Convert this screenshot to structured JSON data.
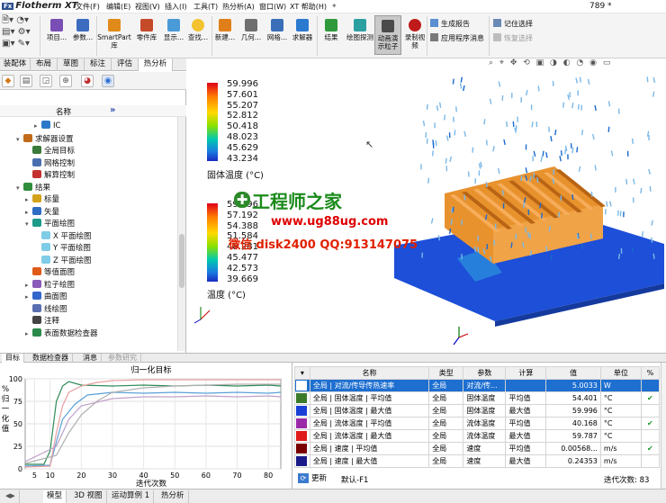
{
  "app": {
    "logo_prefix": "Fx",
    "logo": "Flotherm XT",
    "title_right": "789 *"
  },
  "menu": [
    "文件(F)",
    "编辑(E)",
    "视图(V)",
    "插入(I)",
    "工具(T)",
    "热分析(A)",
    "窗口(W)",
    "XT 帮助(H)"
  ],
  "ribbon": {
    "items": [
      "项目...",
      "参数...",
      "SmartPart 库",
      "零件库",
      "显示...",
      "查找...",
      "新建...",
      "几何...",
      "网格...",
      "求解器",
      "结果",
      "绘图探测",
      "动画演示粒子",
      "录制视频"
    ],
    "right": [
      "生成报告",
      "应用程序消息",
      "记住选择",
      "恢复选择"
    ]
  },
  "left_tabs": [
    "装配体",
    "布局",
    "草图",
    "标注",
    "评估",
    "热分析"
  ],
  "tree": {
    "col_name": "名称",
    "col_arrow": "»",
    "nodes": [
      {
        "label": "IC",
        "depth": 3,
        "exp": "▸",
        "color": "#2a79c8"
      },
      {
        "label": "求解器设置",
        "depth": 1,
        "exp": "▾",
        "color": "#c06a1a"
      },
      {
        "label": "全局目标",
        "depth": 2,
        "exp": "",
        "color": "#3a7a3a"
      },
      {
        "label": "网格控制",
        "depth": 2,
        "exp": "",
        "color": "#4a6fb0"
      },
      {
        "label": "解算控制",
        "depth": 2,
        "exp": "",
        "color": "#c43030"
      },
      {
        "label": "结果",
        "depth": 1,
        "exp": "▾",
        "color": "#2f8d3c"
      },
      {
        "label": "标量",
        "depth": 2,
        "exp": "▸",
        "color": "#d3a21a"
      },
      {
        "label": "矢量",
        "depth": 2,
        "exp": "▸",
        "color": "#2f6cc4"
      },
      {
        "label": "平面绘图",
        "depth": 2,
        "exp": "▾",
        "color": "#1c9a8a"
      },
      {
        "label": "X 平面绘图",
        "depth": 3,
        "exp": "",
        "color": "#7fcce8"
      },
      {
        "label": "Y 平面绘图",
        "depth": 3,
        "exp": "",
        "color": "#7fcce8"
      },
      {
        "label": "Z 平面绘图",
        "depth": 3,
        "exp": "",
        "color": "#7fcce8"
      },
      {
        "label": "等值面图",
        "depth": 2,
        "exp": "",
        "color": "#e05a1a"
      },
      {
        "label": "粒子绘图",
        "depth": 2,
        "exp": "▸",
        "color": "#8a5ab8"
      },
      {
        "label": "曲面图",
        "depth": 2,
        "exp": "▸",
        "color": "#3366cc"
      },
      {
        "label": "线绘图",
        "depth": 2,
        "exp": "",
        "color": "#5a6fb0"
      },
      {
        "label": "注释",
        "depth": 2,
        "exp": "",
        "color": "#444"
      },
      {
        "label": "表面数据检查器",
        "depth": 2,
        "exp": "▸",
        "color": "#2a8a4a"
      }
    ]
  },
  "legend1": {
    "values": [
      "59.996",
      "57.601",
      "55.207",
      "52.812",
      "50.418",
      "48.023",
      "45.629",
      "43.234"
    ],
    "title": "固体温度 (°C)"
  },
  "legend2": {
    "values": [
      "59.996",
      "57.192",
      "54.388",
      "51.584",
      "48.281",
      "45.477",
      "42.573",
      "39.669"
    ],
    "title": "温度 (°C)"
  },
  "watermark": {
    "line1": "工程师之家",
    "line2": "www.ug88ug.com",
    "line3": "微信 disk2400 QQ:913147075"
  },
  "bottom_tabs": [
    "目标",
    "数据检查器",
    "消息",
    "参数研究"
  ],
  "chart_data": {
    "type": "line",
    "title": "归一化目标",
    "xlabel": "迭代次数",
    "ylabel": "% 归一化值",
    "x_ticks": [
      5,
      10,
      20,
      30,
      40,
      50,
      60,
      70,
      80
    ],
    "y_ticks": [
      100,
      75,
      50,
      25,
      0
    ],
    "xlim": [
      2,
      84
    ],
    "ylim": [
      0,
      100
    ],
    "series": [
      {
        "color": "#2e8b57",
        "x": [
          2,
          8,
          10,
          12,
          14,
          16,
          20,
          30,
          40,
          50,
          60,
          70,
          80,
          84
        ],
        "y": [
          5,
          5,
          20,
          75,
          92,
          97,
          93,
          92,
          93,
          92,
          93,
          92,
          93,
          92
        ]
      },
      {
        "color": "#5aa0d8",
        "x": [
          2,
          10,
          12,
          14,
          18,
          22,
          30,
          40,
          50,
          60,
          70,
          80,
          84
        ],
        "y": [
          3,
          4,
          30,
          55,
          72,
          82,
          85,
          84,
          85,
          84,
          85,
          84,
          85
        ]
      },
      {
        "color": "#e8a0a0",
        "x": [
          2,
          10,
          12,
          14,
          16,
          20,
          25,
          30,
          40,
          50,
          60,
          70,
          80,
          84
        ],
        "y": [
          2,
          3,
          40,
          70,
          85,
          92,
          96,
          98,
          99,
          99,
          99,
          99,
          99,
          99
        ]
      },
      {
        "color": "#b0b0b0",
        "x": [
          2,
          12,
          16,
          20,
          25,
          30,
          40,
          50,
          60,
          70,
          80,
          84
        ],
        "y": [
          6,
          15,
          40,
          60,
          75,
          85,
          90,
          92,
          93,
          94,
          94,
          94
        ]
      },
      {
        "color": "#c0a0c8",
        "x": [
          2,
          12,
          16,
          20,
          30,
          40,
          50,
          60,
          70,
          80,
          84
        ],
        "y": [
          8,
          25,
          55,
          70,
          78,
          80,
          80,
          81,
          80,
          81,
          80
        ]
      }
    ]
  },
  "goals": {
    "headers": [
      "名称",
      "类型",
      "参数",
      "计算",
      "值",
      "单位",
      "%"
    ],
    "rows": [
      {
        "color": "#ffffff",
        "name": "全局 | 对流/传导传热速率",
        "type": "全局",
        "param": "对流/传...",
        "calc": "",
        "value": "5.0033",
        "unit": "W",
        "pct": "",
        "sel": true
      },
      {
        "color": "#3c7a2a",
        "name": "全局 | 固体温度 | 平均值",
        "type": "全局",
        "param": "固体温度",
        "calc": "平均值",
        "value": "54.401",
        "unit": "°C",
        "pct": "✔",
        "sel": false
      },
      {
        "color": "#1a3fd6",
        "name": "全局 | 固体温度 | 最大值",
        "type": "全局",
        "param": "固体温度",
        "calc": "最大值",
        "value": "59.996",
        "unit": "°C",
        "pct": "",
        "sel": false
      },
      {
        "color": "#9b2aa8",
        "name": "全局 | 流体温度 | 平均值",
        "type": "全局",
        "param": "流体温度",
        "calc": "平均值",
        "value": "40.168",
        "unit": "°C",
        "pct": "✔",
        "sel": false
      },
      {
        "color": "#e01a1a",
        "name": "全局 | 流体温度 | 最大值",
        "type": "全局",
        "param": "流体温度",
        "calc": "最大值",
        "value": "59.787",
        "unit": "°C",
        "pct": "",
        "sel": false
      },
      {
        "color": "#7a0000",
        "name": "全局 | 速度 | 平均值",
        "type": "全局",
        "param": "速度",
        "calc": "平均值",
        "value": "0.00568...",
        "unit": "m/s",
        "pct": "✔",
        "sel": false
      },
      {
        "color": "#1a1a8a",
        "name": "全局 | 速度 | 最大值",
        "type": "全局",
        "param": "速度",
        "calc": "最大值",
        "value": "0.24353",
        "unit": "m/s",
        "pct": "",
        "sel": false
      }
    ],
    "update_label": "更新",
    "default_label": "默认-F1",
    "iter_label": "迭代次数: 83"
  },
  "foot_tabs": [
    "模型",
    "3D 视图",
    "运动算例 1",
    "热分析"
  ],
  "colors": {
    "selected_row": "#1e6fd0",
    "heatsink": "#e8922e",
    "plate": "#1d4fd8"
  }
}
